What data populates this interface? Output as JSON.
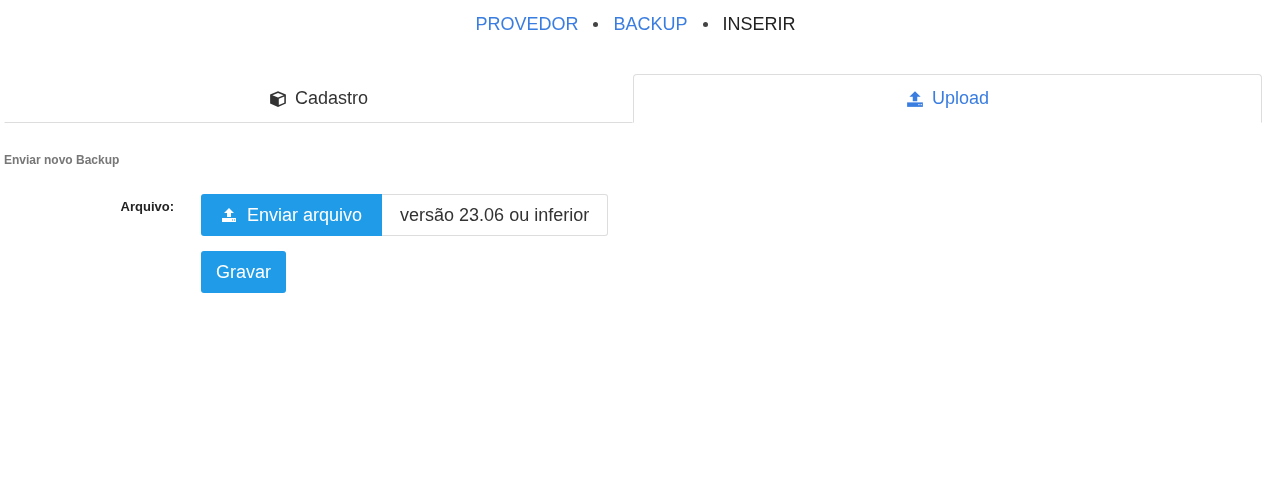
{
  "breadcrumb": [
    {
      "label": "PROVEDOR",
      "current": false
    },
    {
      "label": "BACKUP",
      "current": false
    },
    {
      "label": "INSERIR",
      "current": true
    }
  ],
  "tabs": [
    {
      "label": "Cadastro",
      "kind": "cube",
      "selected": false
    },
    {
      "label": "Upload",
      "kind": "upload",
      "selected": true
    }
  ],
  "section_title": "Enviar novo Backup",
  "form": {
    "label": "Arquivo:",
    "upload_button": "Enviar arquivo",
    "file_text": "versão 23.06 ou inferior",
    "submit_button": "Gravar"
  }
}
